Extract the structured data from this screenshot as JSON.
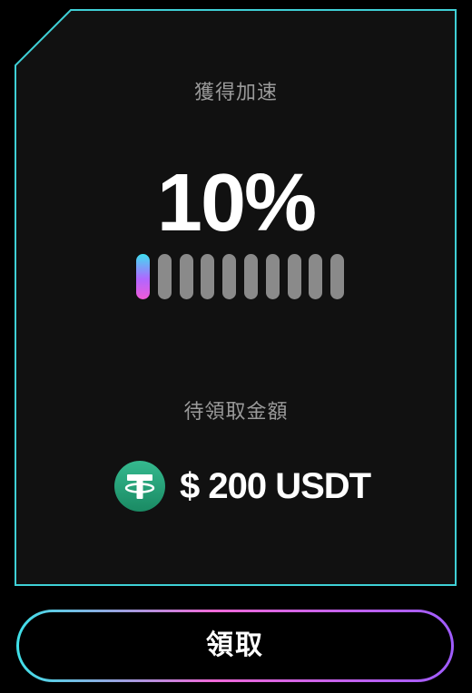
{
  "card": {
    "accel_label": "獲得加速",
    "percent": "10%",
    "progress": {
      "filled": 1,
      "total": 10
    },
    "pending_label": "待領取金額",
    "amount": "$ 200 USDT",
    "token_icon": "usdt-tether-icon"
  },
  "claim_button": {
    "label": "領取"
  },
  "colors": {
    "background": "#000000",
    "card_fill": "#111111",
    "frame_stroke": "#3fd0d6",
    "accent_cyan": "#3ee0f0",
    "accent_purple": "#b067ff",
    "accent_pink": "#f05ad8",
    "bar_inactive": "#8a8a8a",
    "tether_green": "#26a17b"
  }
}
